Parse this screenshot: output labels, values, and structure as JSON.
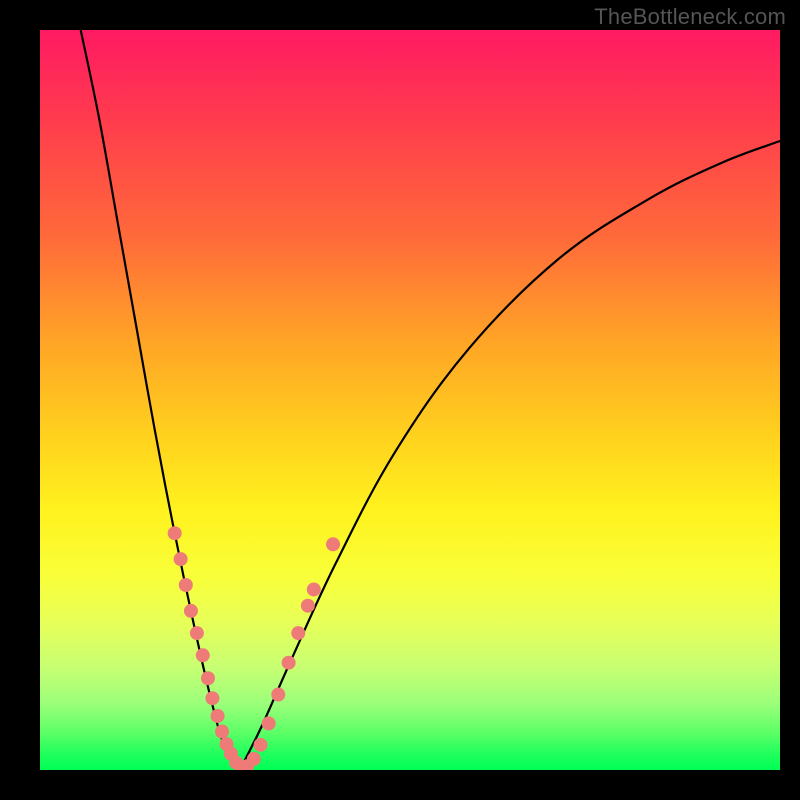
{
  "domain": "Chart",
  "watermark": "TheBottleneck.com",
  "colors": {
    "frame": "#000000",
    "curve": "#000000",
    "markers": "#ee7b78",
    "gradient_stops": [
      {
        "offset": 0.0,
        "hex": "#ff1a63"
      },
      {
        "offset": 0.12,
        "hex": "#ff3b4d"
      },
      {
        "offset": 0.28,
        "hex": "#ff6a3a"
      },
      {
        "offset": 0.42,
        "hex": "#ffa426"
      },
      {
        "offset": 0.55,
        "hex": "#ffd21e"
      },
      {
        "offset": 0.65,
        "hex": "#fff21e"
      },
      {
        "offset": 0.74,
        "hex": "#f8ff3a"
      },
      {
        "offset": 0.8,
        "hex": "#e7ff58"
      },
      {
        "offset": 0.86,
        "hex": "#c8ff72"
      },
      {
        "offset": 0.91,
        "hex": "#9cff7a"
      },
      {
        "offset": 0.95,
        "hex": "#5bff66"
      },
      {
        "offset": 0.98,
        "hex": "#1cff5c"
      },
      {
        "offset": 1.0,
        "hex": "#00ff55"
      }
    ]
  },
  "chart_data": {
    "type": "line",
    "title": "",
    "xlabel": "",
    "ylabel": "",
    "xlim": [
      0,
      1
    ],
    "ylim": [
      0,
      1
    ],
    "note": "Bottleneck-style V-curve displayed over a severity gradient. The vertical axis reads top=1 (red / severe mismatch) down to bottom=0 (green / balanced). The horizontal axis is a normalized hardware ratio with the minimum (optimal match) near x≈0.27.",
    "series": [
      {
        "name": "left-branch",
        "x": [
          0.055,
          0.08,
          0.105,
          0.13,
          0.155,
          0.18,
          0.205,
          0.23,
          0.25,
          0.27
        ],
        "y": [
          1.0,
          0.88,
          0.74,
          0.6,
          0.46,
          0.33,
          0.21,
          0.1,
          0.03,
          0.0
        ]
      },
      {
        "name": "right-branch",
        "x": [
          0.27,
          0.3,
          0.34,
          0.4,
          0.48,
          0.58,
          0.7,
          0.82,
          0.92,
          1.0
        ],
        "y": [
          0.0,
          0.06,
          0.15,
          0.28,
          0.43,
          0.57,
          0.69,
          0.77,
          0.82,
          0.85
        ]
      }
    ],
    "markers": {
      "name": "highlighted-points",
      "note": "Salmon-colored sample dots clustered near the trough of the V.",
      "points": [
        {
          "x": 0.182,
          "y": 0.32
        },
        {
          "x": 0.19,
          "y": 0.285
        },
        {
          "x": 0.197,
          "y": 0.25
        },
        {
          "x": 0.204,
          "y": 0.215
        },
        {
          "x": 0.212,
          "y": 0.185
        },
        {
          "x": 0.22,
          "y": 0.155
        },
        {
          "x": 0.227,
          "y": 0.124
        },
        {
          "x": 0.233,
          "y": 0.097
        },
        {
          "x": 0.24,
          "y": 0.073
        },
        {
          "x": 0.246,
          "y": 0.052
        },
        {
          "x": 0.252,
          "y": 0.035
        },
        {
          "x": 0.258,
          "y": 0.022
        },
        {
          "x": 0.265,
          "y": 0.01
        },
        {
          "x": 0.272,
          "y": 0.004
        },
        {
          "x": 0.28,
          "y": 0.005
        },
        {
          "x": 0.289,
          "y": 0.015
        },
        {
          "x": 0.298,
          "y": 0.034
        },
        {
          "x": 0.309,
          "y": 0.063
        },
        {
          "x": 0.322,
          "y": 0.102
        },
        {
          "x": 0.336,
          "y": 0.145
        },
        {
          "x": 0.349,
          "y": 0.185
        },
        {
          "x": 0.362,
          "y": 0.222
        },
        {
          "x": 0.37,
          "y": 0.244
        },
        {
          "x": 0.396,
          "y": 0.305
        }
      ]
    }
  }
}
